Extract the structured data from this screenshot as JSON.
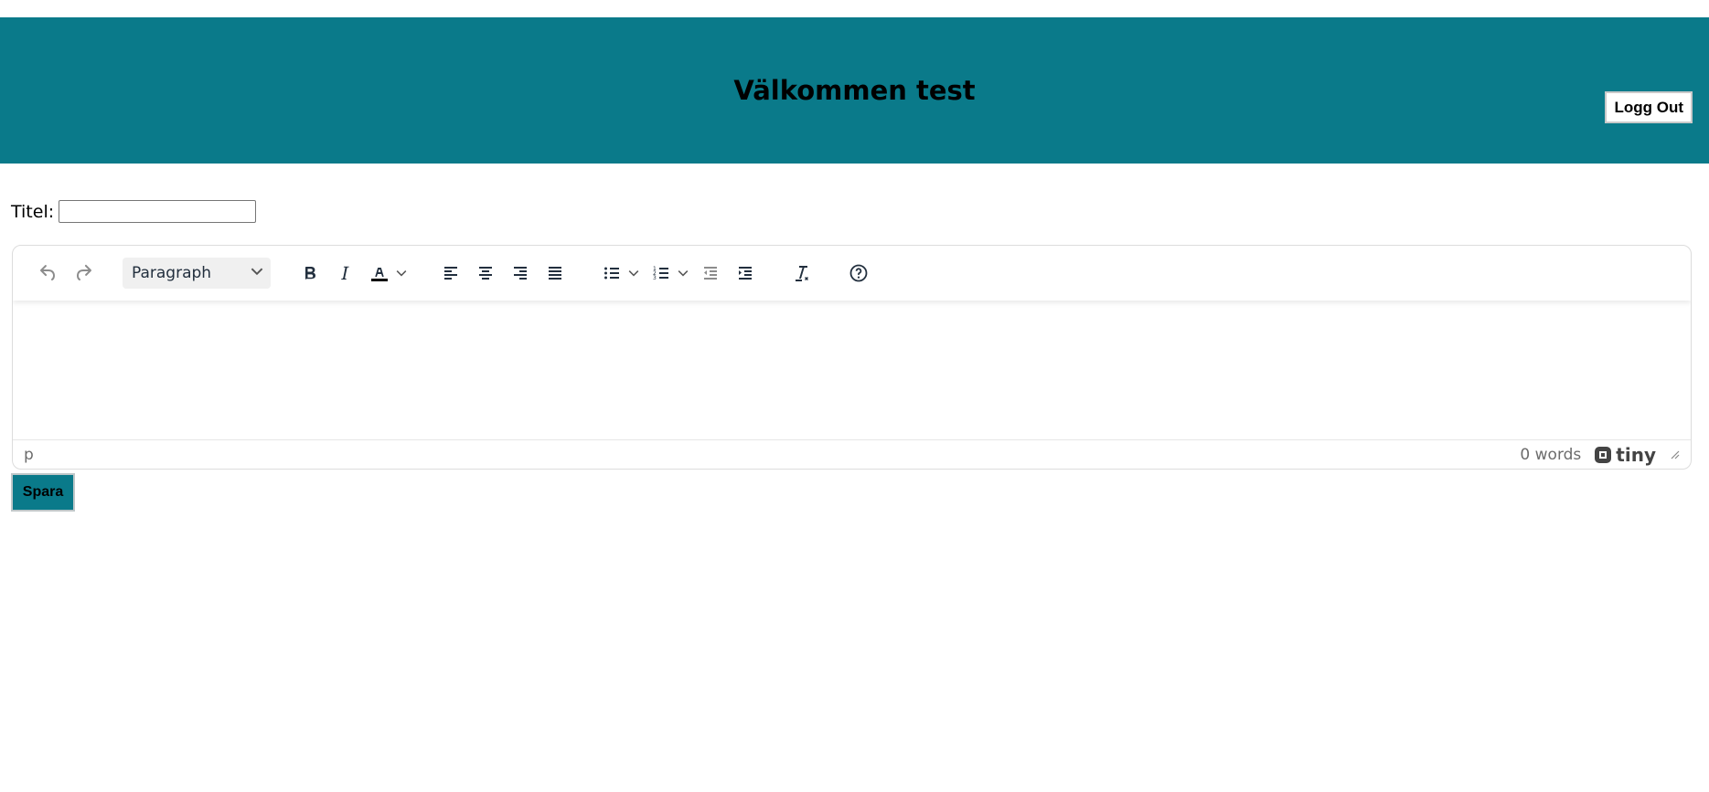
{
  "header": {
    "title": "Välkommen test",
    "logout_label": "Logg Out",
    "background": "#0a7a8a"
  },
  "form": {
    "title_label": "Titel:",
    "title_value": "",
    "save_label": "Spara"
  },
  "editor": {
    "block_format": "Paragraph",
    "toolbar_icons": [
      "undo-icon",
      "redo-icon",
      "bold-icon",
      "italic-icon",
      "text-color-icon",
      "align-left-icon",
      "align-center-icon",
      "align-right-icon",
      "align-justify-icon",
      "bullet-list-icon",
      "numbered-list-icon",
      "outdent-icon",
      "indent-icon",
      "clear-formatting-icon",
      "help-icon"
    ],
    "status_path": "p",
    "word_count": "0 words",
    "brand": "tiny"
  }
}
